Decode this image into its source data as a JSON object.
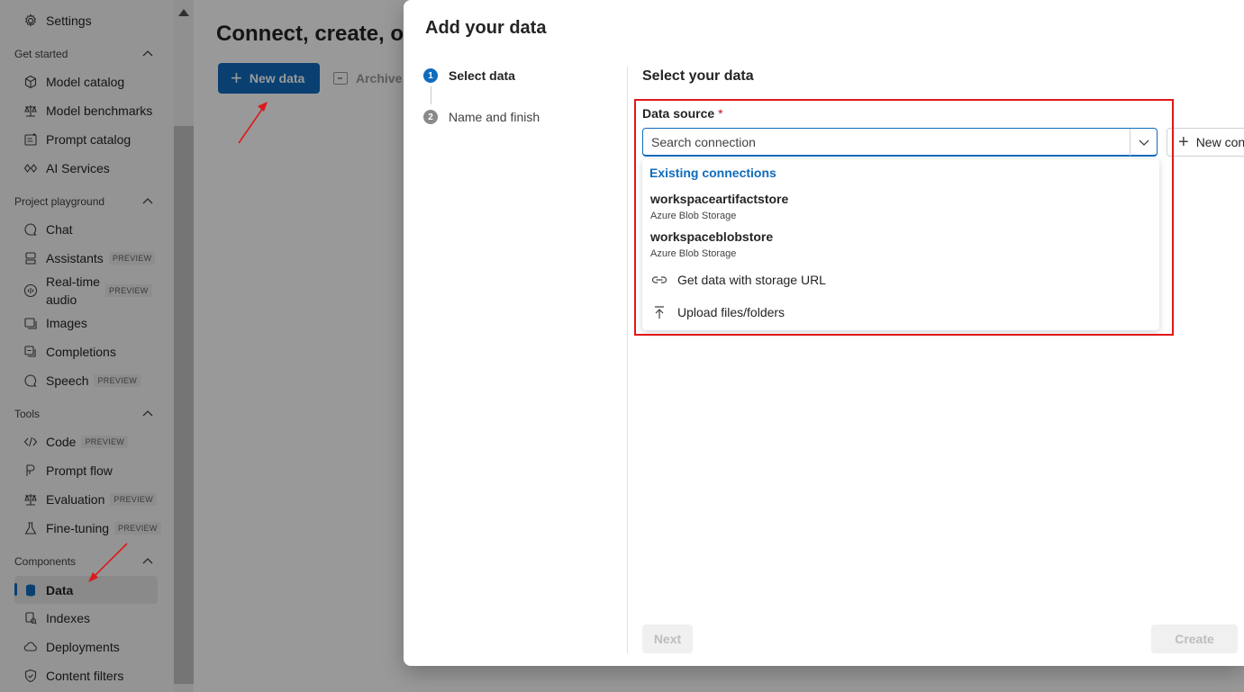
{
  "sidebar": {
    "settings_label": "Settings",
    "sections": {
      "get_started": "Get started",
      "project_playground": "Project playground",
      "tools": "Tools",
      "components": "Components"
    },
    "get_started_items": [
      "Model catalog",
      "Model benchmarks",
      "Prompt catalog",
      "AI Services"
    ],
    "playground_items": [
      {
        "label": "Chat",
        "badge": ""
      },
      {
        "label": "Assistants",
        "badge": "PREVIEW"
      },
      {
        "label": "Real-time audio",
        "badge": "PREVIEW"
      },
      {
        "label": "Images",
        "badge": ""
      },
      {
        "label": "Completions",
        "badge": ""
      },
      {
        "label": "Speech",
        "badge": "PREVIEW"
      }
    ],
    "tools_items": [
      {
        "label": "Code",
        "badge": "PREVIEW"
      },
      {
        "label": "Prompt flow",
        "badge": ""
      },
      {
        "label": "Evaluation",
        "badge": "PREVIEW"
      },
      {
        "label": "Fine-tuning",
        "badge": "PREVIEW"
      }
    ],
    "components_items": [
      "Data",
      "Indexes",
      "Deployments",
      "Content filters"
    ]
  },
  "main": {
    "title": "Connect, create, or",
    "new_data_label": "New data",
    "archive_label": "Archive"
  },
  "dialog": {
    "title": "Add your data",
    "steps": [
      {
        "num": "1",
        "label": "Select data"
      },
      {
        "num": "2",
        "label": "Name and finish"
      }
    ],
    "section_title": "Select your data",
    "data_source_label": "Data source",
    "required_mark": "*",
    "search_placeholder": "Search connection",
    "new_connection_label": "New connection",
    "existing_connections_header": "Existing connections",
    "connections": [
      {
        "name": "workspaceartifactstore",
        "type": "Azure Blob Storage"
      },
      {
        "name": "workspaceblobstore",
        "type": "Azure Blob Storage"
      }
    ],
    "actions": [
      "Get data with storage URL",
      "Upload files/folders"
    ],
    "next_label": "Next",
    "create_label": "Create"
  },
  "colors": {
    "accent": "#0f6cbd",
    "annotation": "#e01818"
  }
}
